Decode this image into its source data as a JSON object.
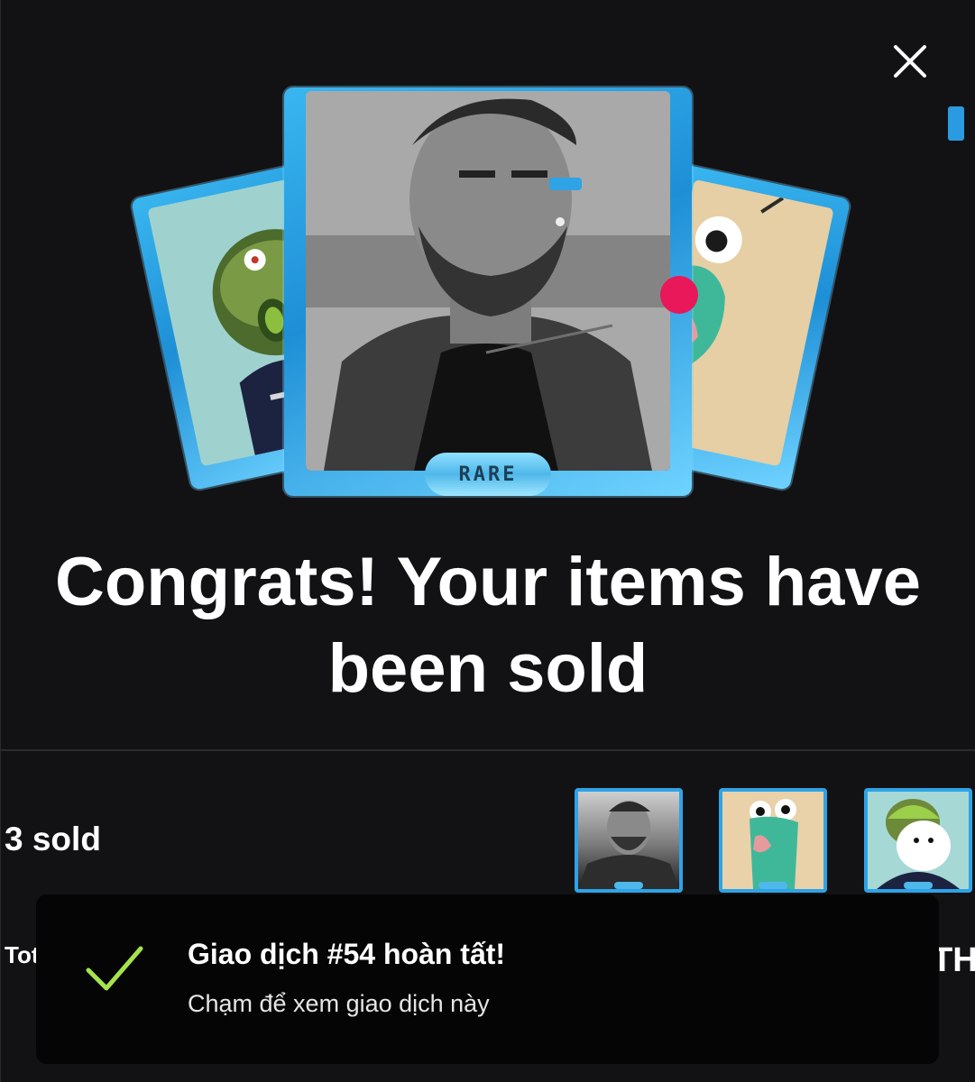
{
  "modal": {
    "close_icon": "close-icon",
    "rarity_label": "RARE",
    "title": "Congrats! Your items have been sold",
    "sold_count": "3 sold",
    "partial_total_label": "Tot",
    "partial_eth_label": "TH",
    "accent_color": "#2ea3e6"
  },
  "toast": {
    "icon": "checkmark-icon",
    "title": "Giao dịch #54 hoàn tất!",
    "subtitle": "Chạm để xem giao dịch này",
    "check_color": "#a6e34a"
  }
}
